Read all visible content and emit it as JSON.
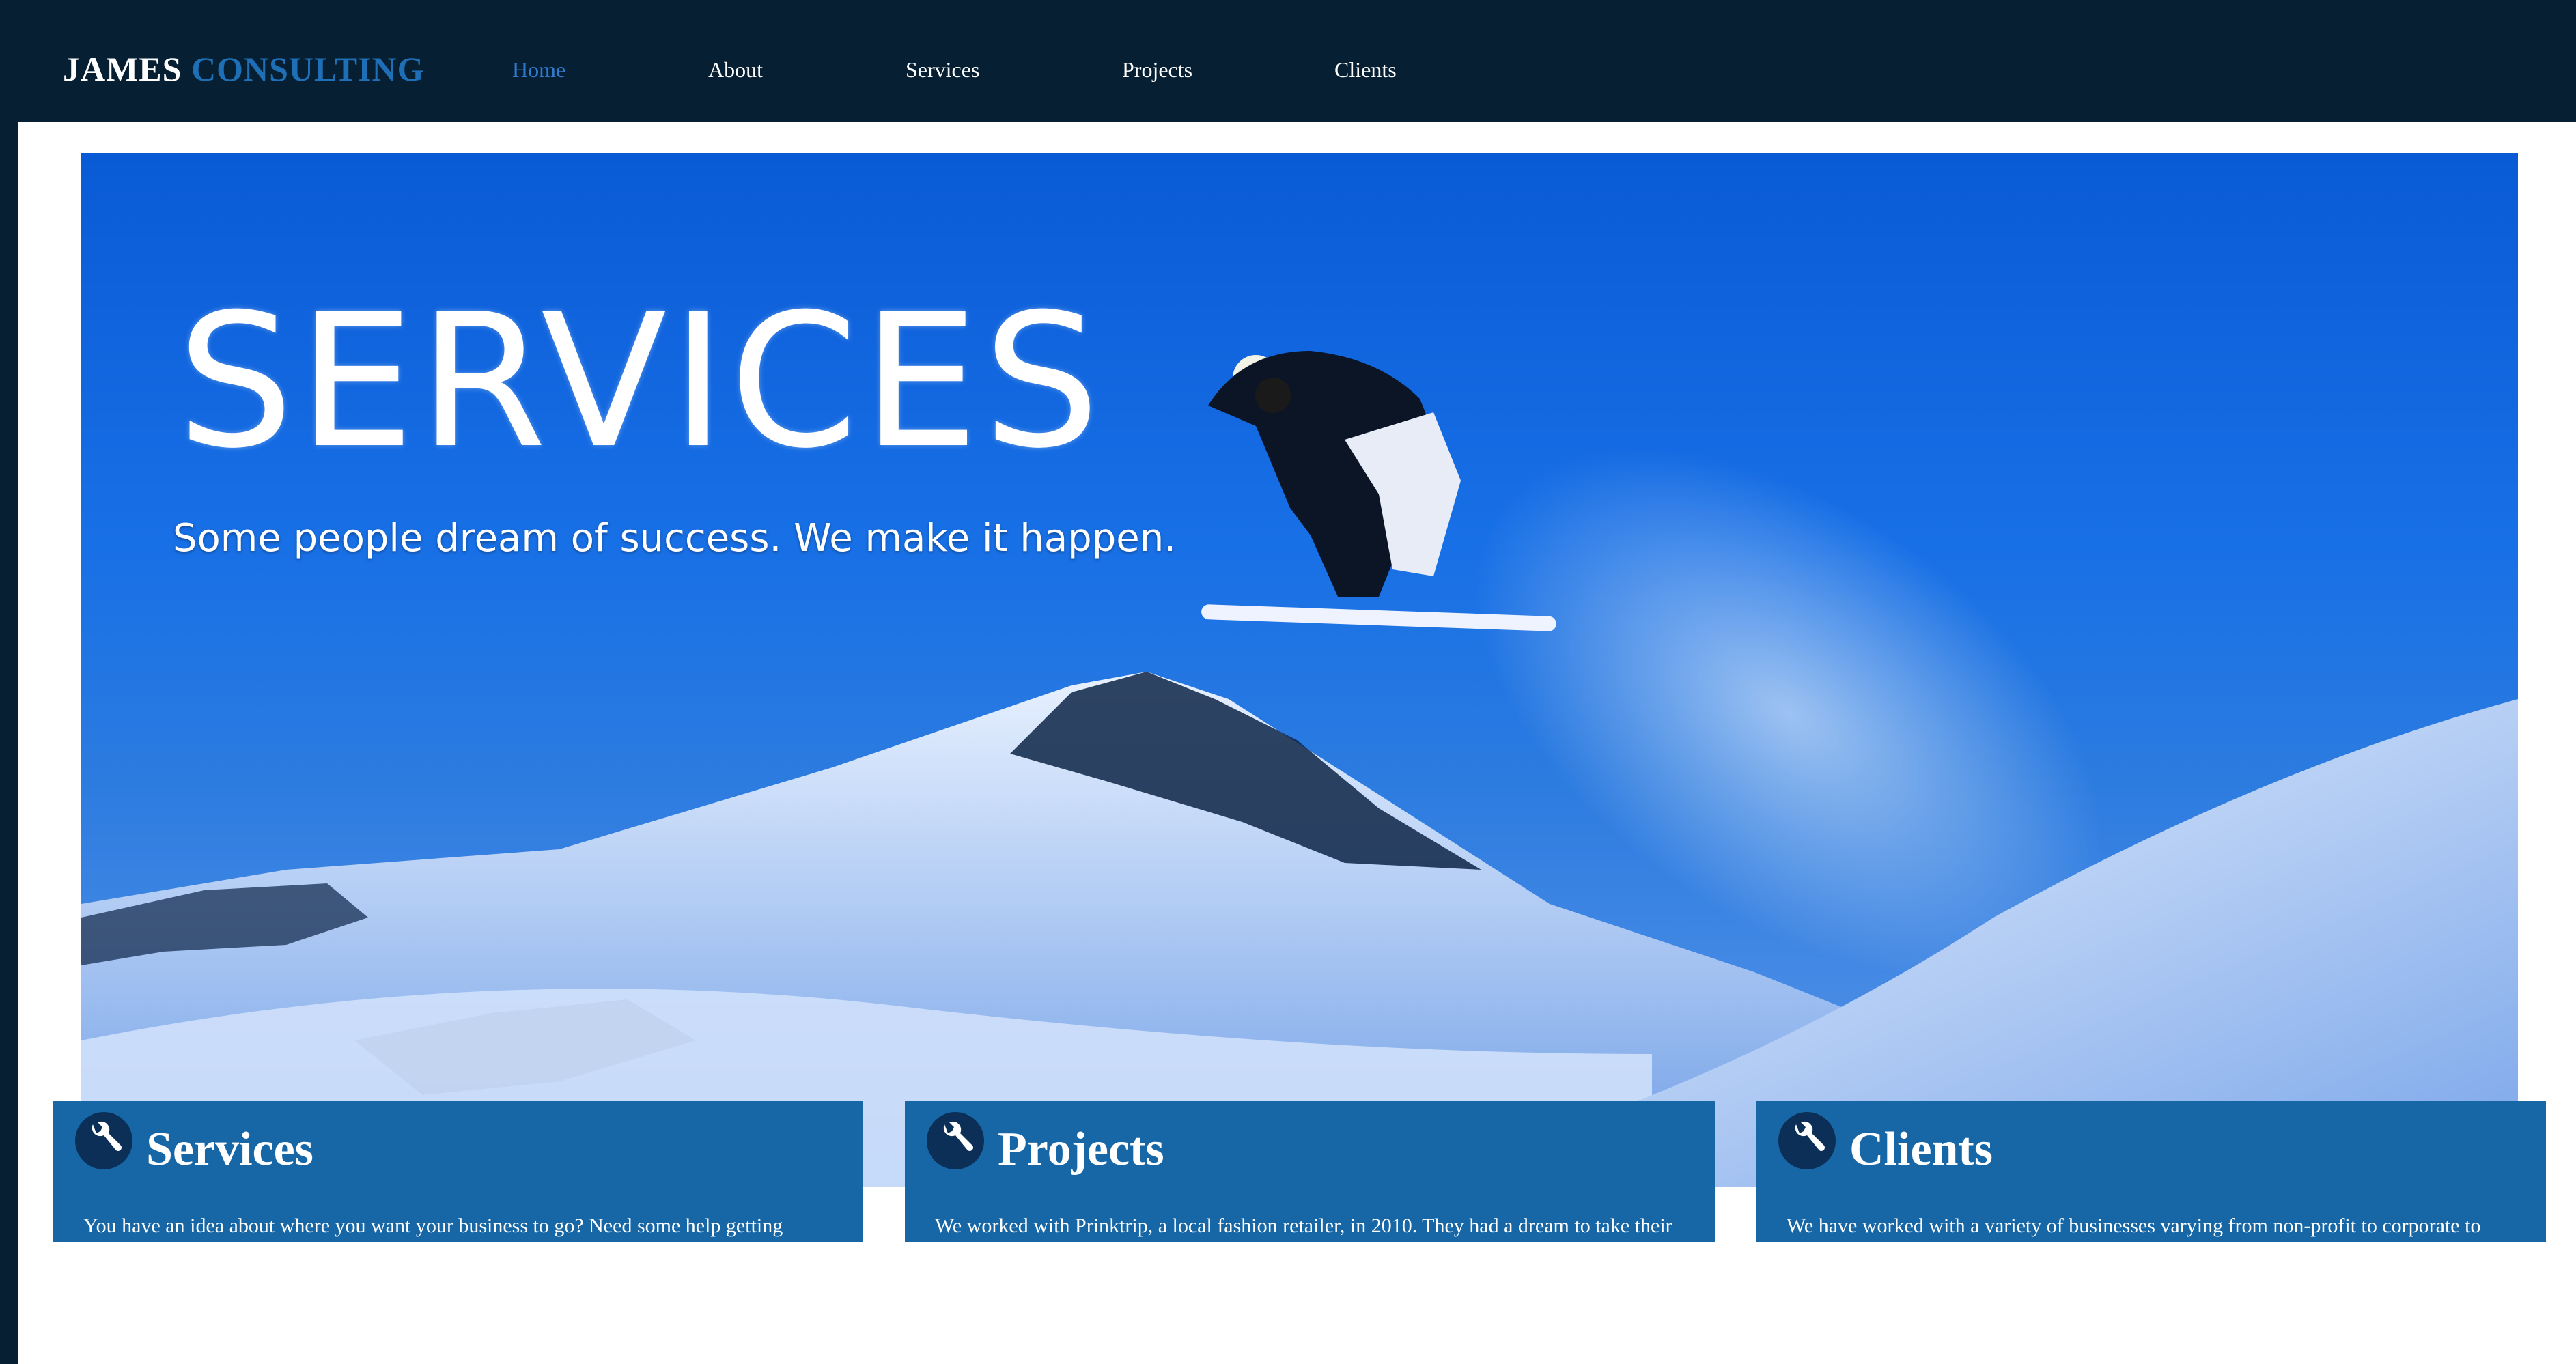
{
  "brand": {
    "part1": "JAMES",
    "part2": "CONSULTING"
  },
  "nav": {
    "items": [
      {
        "label": "Home",
        "active": true
      },
      {
        "label": "About",
        "active": false
      },
      {
        "label": "Services",
        "active": false
      },
      {
        "label": "Projects",
        "active": false
      },
      {
        "label": "Clients",
        "active": false
      }
    ]
  },
  "hero": {
    "title": "SERVICES",
    "subtitle": "Some people dream of success. We make it happen."
  },
  "cards": [
    {
      "icon": "wrench-icon",
      "title": "Services",
      "text": "You have an idea about where you want your business to go? Need some help getting"
    },
    {
      "icon": "wrench-icon",
      "title": "Projects",
      "text": "We worked with Prinktrip, a local fashion retailer, in 2010. They had a dream to take their"
    },
    {
      "icon": "wrench-icon",
      "title": "Clients",
      "text": "We have worked with a variety of businesses varying from non-profit to corporate to"
    }
  ],
  "colors": {
    "header_bg": "#061f33",
    "accent_blue": "#1e6fb6",
    "card_bg": "#1766a6",
    "nav_active": "#2f7bd0"
  }
}
